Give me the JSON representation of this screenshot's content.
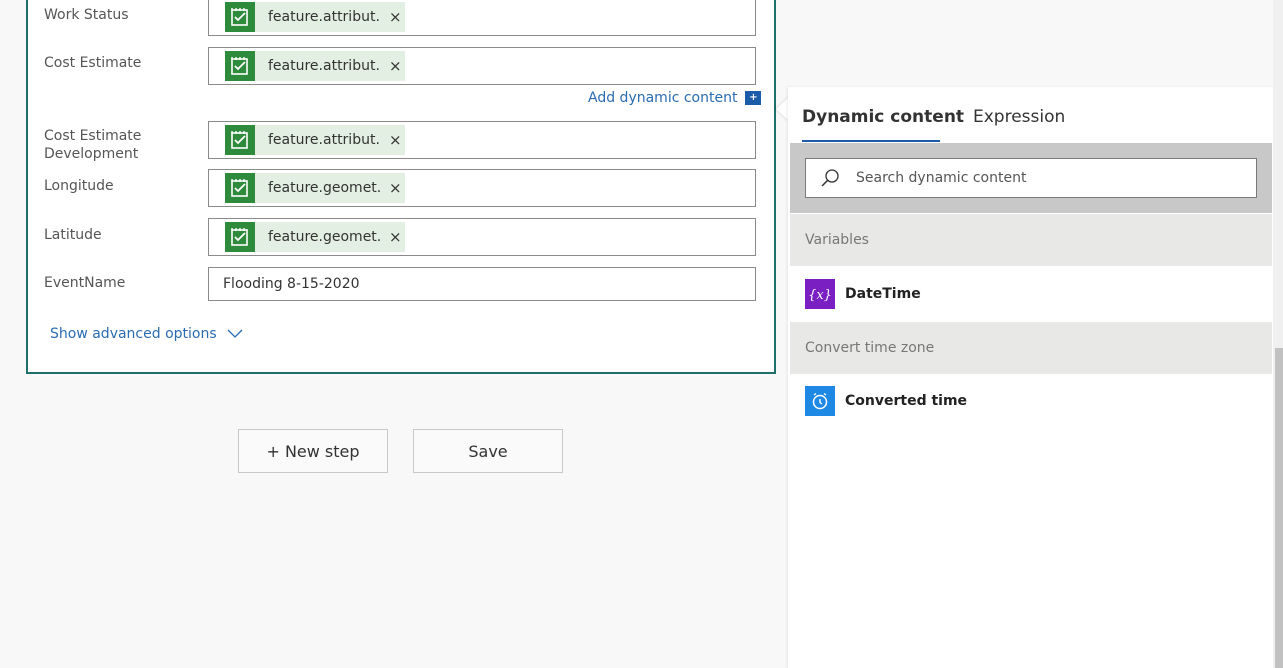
{
  "card": {
    "fields": [
      {
        "label": "Work Status",
        "token": "feature.attribut...",
        "close": "×"
      },
      {
        "label": "Cost Estimate",
        "token": "feature.attribut...",
        "close": "×"
      },
      {
        "label": "Cost Estimate Development",
        "token": "feature.attribut...",
        "close": "×"
      },
      {
        "label": "Longitude",
        "token": "feature.geomet...",
        "close": "×"
      },
      {
        "label": "Latitude",
        "token": "feature.geomet...",
        "close": "×"
      },
      {
        "label": "EventName",
        "value": "Flooding 8-15-2020"
      }
    ],
    "add_dynamic_label": "Add dynamic content",
    "add_dynamic_plus": "+",
    "show_advanced_label": "Show advanced options"
  },
  "steps": {
    "new_step_label": "+ New step",
    "save_label": "Save"
  },
  "panel": {
    "tabs": [
      {
        "label": "Dynamic content",
        "active": true
      },
      {
        "label": "Expression",
        "active": false
      }
    ],
    "search_placeholder": "Search dynamic content",
    "sections": [
      {
        "header": "Variables",
        "items": [
          {
            "label": "DateTime",
            "icon": "variable-icon",
            "color": "#7a1fc2"
          }
        ]
      },
      {
        "header": "Convert time zone",
        "items": [
          {
            "label": "Converted time",
            "icon": "clock-icon",
            "color": "#1e88e5"
          }
        ]
      }
    ]
  },
  "colors": {
    "card_border": "#1f6f6a",
    "token_icon": "#2e8b3c",
    "token_bg": "#e3efe2",
    "link": "#2b6cb0",
    "tab_underline": "#1a5ca8"
  }
}
